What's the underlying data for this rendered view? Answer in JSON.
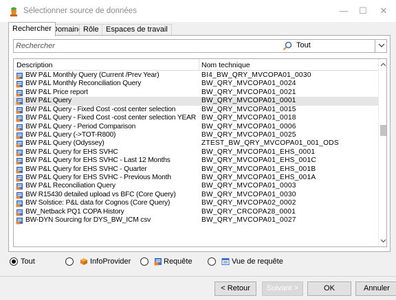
{
  "window": {
    "title": "Sélectionner source de données",
    "minimize_glyph": "—",
    "maximize_glyph": "☐",
    "close_glyph": "✕"
  },
  "tabs": [
    {
      "label": "Rechercher",
      "active": true
    },
    {
      "label": "Domaine",
      "active": false
    },
    {
      "label": "Rôle",
      "active": false
    },
    {
      "label": "Espaces de travail",
      "active": false
    }
  ],
  "search": {
    "placeholder": "Rechercher",
    "value": "",
    "scope_value": "Tout"
  },
  "table": {
    "columns": {
      "description": "Description",
      "technical_name": "Nom technique"
    },
    "selected_index": 3,
    "rows": [
      {
        "description": "BW P&L Monthly Query (Current /Prev Year)",
        "technical_name": "BI4_BW_QRY_MVCOPA01_0030"
      },
      {
        "description": "BW P&L Monthly Reconciliation Query",
        "technical_name": "BW_QRY_MVCOPA01_0024"
      },
      {
        "description": "BW P&L Price report",
        "technical_name": "BW_QRY_MVCOPA01_0021"
      },
      {
        "description": "BW P&L Query",
        "technical_name": "BW_QRY_MVCOPA01_0001"
      },
      {
        "description": "BW P&L Query - Fixed Cost -cost center selection",
        "technical_name": "BW_QRY_MVCOPA01_0015"
      },
      {
        "description": "BW P&L Query - Fixed Cost -cost center selection YEAR",
        "technical_name": "BW_QRY_MVCOPA01_0018"
      },
      {
        "description": "BW P&L Query - Period Comparison",
        "technical_name": "BW_QRY_MVCOPA01_0006"
      },
      {
        "description": "BW P&L Query (->TOT-R800)",
        "technical_name": "BW_QRY_MVCOPA01_0025"
      },
      {
        "description": "BW P&L Query (Odyssey)",
        "technical_name": "ZTEST_BW_QRY_MVCOPA01_001_ODS"
      },
      {
        "description": "BW P&L Query for EHS SVHC",
        "technical_name": "BW_QRY_MVCOPA01_EHS_0001"
      },
      {
        "description": "BW P&L Query for EHS SVHC -  Last 12 Months",
        "technical_name": "BW_QRY_MVCOPA01_EHS_001C"
      },
      {
        "description": "BW P&L Query for EHS SVHC -  Quarter",
        "technical_name": "BW_QRY_MVCOPA01_EHS_001B"
      },
      {
        "description": "BW P&L Query for EHS SVHC - Previous Month",
        "technical_name": "BW_QRY_MVCOPA01_EHS_001A"
      },
      {
        "description": "BW P&L Reconciliation Query",
        "technical_name": "BW_QRY_MVCOPA01_0003"
      },
      {
        "description": "BW R15430 detailed upload vs BFC (Core Query)",
        "technical_name": "BW_QRY_MVCOPA01_0030"
      },
      {
        "description": "BW Solstice: P&L data for Cognos (Core Query)",
        "technical_name": "BW_QRY_MVCOPA02_0002"
      },
      {
        "description": "BW_Netback PQ1 COPA History",
        "technical_name": "BW_QRY_CRCOPA28_0001"
      },
      {
        "description": "BW-DYN Sourcing for DYS_BW_ICM csv",
        "technical_name": "BW_QRY_MVCOPA01_0027"
      }
    ]
  },
  "filters": {
    "selected": "Tout",
    "options": [
      {
        "label": "Tout",
        "icon": "none"
      },
      {
        "label": "InfoProvider",
        "icon": "cube-icon"
      },
      {
        "label": "Requête",
        "icon": "query-icon"
      },
      {
        "label": "Vue de requête",
        "icon": "query-view-icon"
      }
    ]
  },
  "buttons": {
    "back": "< Retour",
    "next": "Suivant >",
    "ok": "OK",
    "cancel": "Annuler"
  },
  "colors": {
    "query_icon_blue": "#3d6fc4",
    "query_icon_orange": "#e8862a",
    "selected_row": "#e5e5e5"
  }
}
